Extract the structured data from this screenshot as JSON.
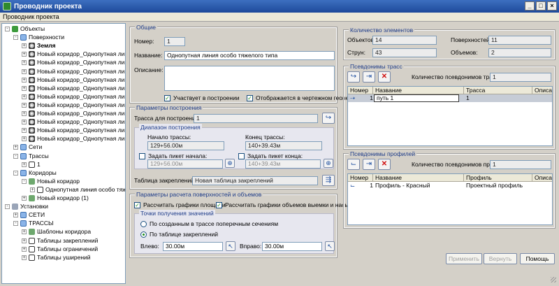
{
  "window": {
    "title": "Проводник проекта",
    "buttons": [
      "_",
      "□",
      "×"
    ]
  },
  "toolbar": {
    "label": "Проводник проекта"
  },
  "tree": [
    {
      "label": "Объекты",
      "indent": 0,
      "icon": "objects-icon",
      "pm": "-"
    },
    {
      "label": "Поверхности",
      "indent": 1,
      "icon": "surfaces-icon",
      "pm": "-"
    },
    {
      "label": "Земля",
      "indent": 2,
      "icon": "surface-icon",
      "pm": "+",
      "bold": true
    },
    {
      "label": "Новый коридор_Однопутная линия о",
      "indent": 2,
      "icon": "surface-icon",
      "pm": "+"
    },
    {
      "label": "Новый коридор_Однопутная линия о",
      "indent": 2,
      "icon": "surface-icon",
      "pm": "+"
    },
    {
      "label": "Новый коридор_Однопутная линия о",
      "indent": 2,
      "icon": "surface-icon",
      "pm": "+"
    },
    {
      "label": "Новый коридор_Однопутная линия о",
      "indent": 2,
      "icon": "surface-icon",
      "pm": "+"
    },
    {
      "label": "Новый коридор_Однопутная линия о",
      "indent": 2,
      "icon": "surface-icon",
      "pm": "+"
    },
    {
      "label": "Новый коридор_Однопутная линия о",
      "indent": 2,
      "icon": "surface-icon",
      "pm": "+"
    },
    {
      "label": "Новый коридор_Однопутная линия о",
      "indent": 2,
      "icon": "surface-icon",
      "pm": "+"
    },
    {
      "label": "Новый коридор_Однопутная линия о",
      "indent": 2,
      "icon": "surface-icon",
      "pm": "+"
    },
    {
      "label": "Новый коридор_Однопутная линия о",
      "indent": 2,
      "icon": "surface-icon",
      "pm": "+"
    },
    {
      "label": "Новый коридор_Однопутная линия о",
      "indent": 2,
      "icon": "surface-icon",
      "pm": "+"
    },
    {
      "label": "Новый коридор_Однопутная линия о",
      "indent": 2,
      "icon": "surface-icon",
      "pm": "+"
    },
    {
      "label": "Сети",
      "indent": 1,
      "icon": "networks-icon",
      "pm": "+"
    },
    {
      "label": "Трассы",
      "indent": 1,
      "icon": "routes-icon",
      "pm": "-"
    },
    {
      "label": "1",
      "indent": 2,
      "icon": "route-icon",
      "pm": "+"
    },
    {
      "label": "Коридоры",
      "indent": 1,
      "icon": "corridors-icon",
      "pm": "-"
    },
    {
      "label": "Новый коридор",
      "indent": 2,
      "icon": "corridor-icon",
      "pm": "-"
    },
    {
      "label": "Однопутная линия особо тяжелого",
      "indent": 3,
      "icon": "corridor-line-icon",
      "pm": "+"
    },
    {
      "label": "Новый коридор (1)",
      "indent": 2,
      "icon": "corridor-icon",
      "pm": "+"
    },
    {
      "label": "Установки",
      "indent": 0,
      "icon": "settings-icon",
      "pm": "-"
    },
    {
      "label": "СЕТИ",
      "indent": 1,
      "icon": "networks-icon",
      "pm": "+"
    },
    {
      "label": "ТРАССЫ",
      "indent": 1,
      "icon": "routes-icon",
      "pm": "-"
    },
    {
      "label": "Шаблоны коридора",
      "indent": 2,
      "icon": "template-icon",
      "pm": "+"
    },
    {
      "label": "Таблицы закреплений",
      "indent": 2,
      "icon": "table-icon",
      "pm": "+"
    },
    {
      "label": "Таблицы ограничений",
      "indent": 2,
      "icon": "table-icon",
      "pm": "+"
    },
    {
      "label": "Таблицы уширений",
      "indent": 2,
      "icon": "table-icon",
      "pm": "+"
    }
  ],
  "general": {
    "title": "Общие",
    "number_label": "Номер:",
    "number_value": "1",
    "name_label": "Название:",
    "name_value": "Однопутная линия особо тяжелого типа",
    "desc_label": "Описание:",
    "desc_value": "",
    "participates": "Участвует в построении",
    "shown_in_drawing": "Отображается в чертежном геоне"
  },
  "build": {
    "title": "Параметры построения",
    "route_label": "Трасса для построения:",
    "route_value": "1",
    "range_title": "Диапазон построения",
    "start_label": "Начало трассы:",
    "start_value": "129+56.00м",
    "end_label": "Конец трассы:",
    "end_value": "140+39.43м",
    "set_start": "Задать пикет начала:",
    "set_start_value": "129+56.00м",
    "set_end": "Задать пикет конца:",
    "set_end_value": "140+39.43м",
    "fix_table_label": "Таблица закреплений:",
    "fix_table_value": "Новая таблица закреплений"
  },
  "calc": {
    "title": "Параметры расчета поверхностей и объемов",
    "area_graphs": "Рассчитать графики площади",
    "volume_graphs": "Рассчитать графики объемов выемки и насыпи",
    "points_title": "Точки получения значений",
    "by_sections": "По созданным в трассе поперечным сечениям",
    "by_table": "По таблице закреплений",
    "left_label": "Влево:",
    "left_value": "30.00м",
    "right_label": "Вправо:",
    "right_value": "30.00м"
  },
  "counts": {
    "title": "Количество элементов",
    "objects_label": "Объектов:",
    "objects_value": "14",
    "surfaces_label": "Поверхностей:",
    "surfaces_value": "11",
    "strings_label": "Струн:",
    "strings_value": "43",
    "volumes_label": "Объемов:",
    "volumes_value": "2"
  },
  "route_aliases": {
    "title": "Псевдонимы трасс",
    "count_label": "Количество псевдонимов трасс:",
    "count_value": "1",
    "columns": [
      "Номер",
      "Название",
      "Трасса",
      "Описа"
    ],
    "rows": [
      {
        "num": "1",
        "name": "путь 1",
        "route": "1",
        "desc": ""
      }
    ]
  },
  "profile_aliases": {
    "title": "Псевдонимы профилей",
    "count_label": "Количество псевдонимов профилей:",
    "count_value": "1",
    "columns": [
      "Номер",
      "Название",
      "Профиль",
      "Описа"
    ],
    "rows": [
      {
        "num": "1",
        "name": "Профиль - Красный",
        "profile": "Проектный профиль",
        "desc": ""
      }
    ]
  },
  "footer": {
    "apply": "Применить",
    "revert": "Вернуть",
    "help": "Помощь"
  },
  "colors": {
    "title_bar": "#1e4a9a",
    "group_title": "#1f3d8a",
    "delete": "#d01010"
  }
}
